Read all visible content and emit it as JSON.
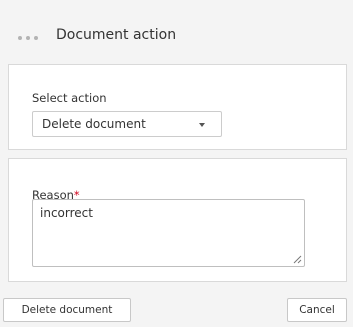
{
  "dialog": {
    "title": "Document action",
    "menu_icon": "ellipsis-icon"
  },
  "action_section": {
    "label": "Select action",
    "selected_value": "Delete document",
    "dropdown_icon": "chevron-down-icon"
  },
  "reason_section": {
    "label": "Reason",
    "required_marker": "*",
    "value": "incorrect",
    "resize_icon": "resize-grip-icon"
  },
  "footer": {
    "confirm_label": "Delete document",
    "cancel_label": "Cancel"
  },
  "colors": {
    "required": "#d0021b",
    "dialog_background": "#f4f4f4",
    "panel_background": "#ffffff"
  }
}
